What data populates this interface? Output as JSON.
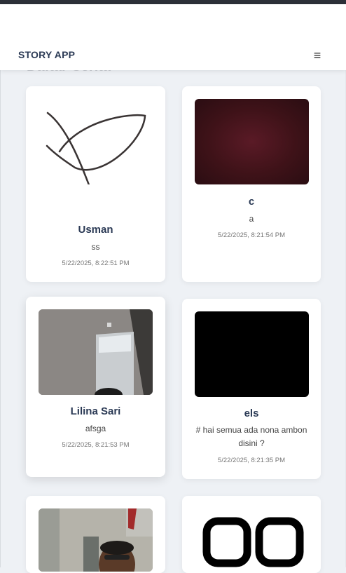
{
  "header": {
    "brand": "STORY APP",
    "menu_icon": "≡"
  },
  "page": {
    "section_title": "Daftar Cerita"
  },
  "stories": [
    {
      "name": "Usman",
      "description": "ss",
      "date": "5/22/2025, 8:22:51 PM"
    },
    {
      "name": "c",
      "description": "a",
      "date": "5/22/2025, 8:21:54 PM"
    },
    {
      "name": "Lilina Sari",
      "description": "afsga",
      "date": "5/22/2025, 8:21:53 PM"
    },
    {
      "name": "els",
      "description": "# hai semua ada nona ambon disini ?",
      "date": "5/22/2025, 8:21:35 PM"
    }
  ]
}
